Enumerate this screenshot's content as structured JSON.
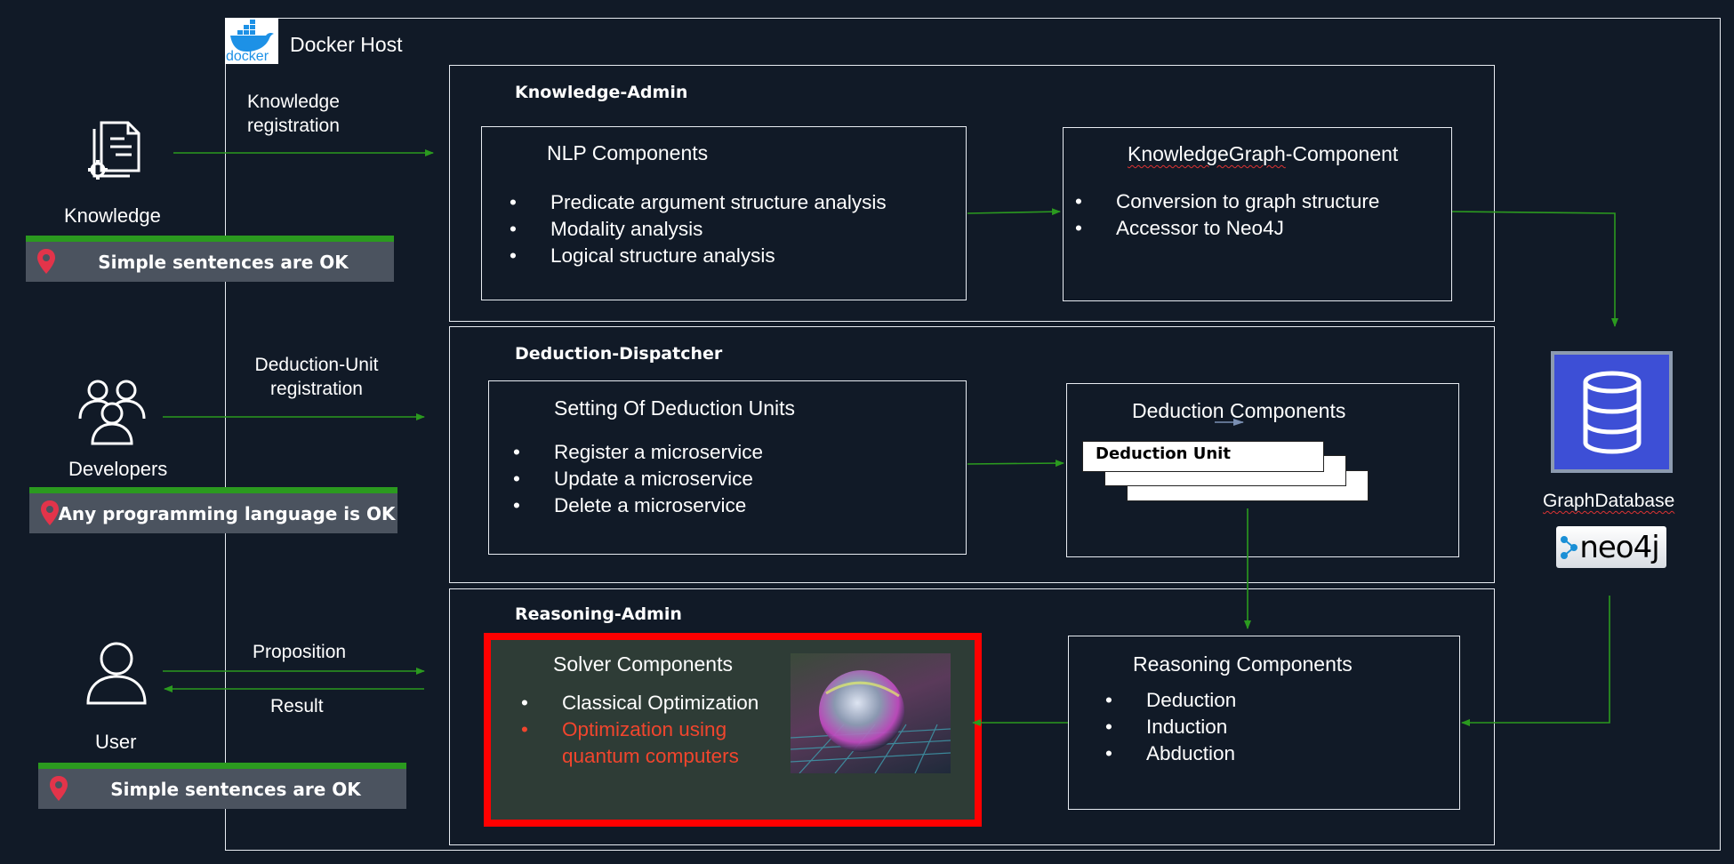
{
  "host": {
    "title": "Docker Host",
    "logo_text": "docker"
  },
  "actors": {
    "knowledge": {
      "label": "Knowledge",
      "note": "Simple sentences are OK",
      "flow": [
        "Knowledge",
        "registration"
      ]
    },
    "developers": {
      "label": "Developers",
      "note": "Any programming language is OK",
      "flow": [
        "Deduction-Unit",
        "registration"
      ]
    },
    "user": {
      "label": "User",
      "note": "Simple sentences are OK",
      "flow_in": "Proposition",
      "flow_out": "Result"
    }
  },
  "sections": {
    "knowledge_admin": {
      "title": "Knowledge-Admin",
      "nlp": {
        "title": "NLP Components",
        "items": [
          "Predicate argument structure analysis",
          "Modality analysis",
          "Logical structure analysis"
        ]
      },
      "kg": {
        "title_a": "KnowledgeGraph",
        "title_b": "-Component",
        "items": [
          "Conversion to graph structure",
          "Accessor to Neo4J"
        ]
      }
    },
    "deduction_dispatcher": {
      "title": "Deduction-Dispatcher",
      "setting": {
        "title": "Setting Of Deduction Units",
        "items": [
          "Register a microservice",
          "Update a microservice",
          "Delete a microservice"
        ]
      },
      "deduction": {
        "title": "Deduction Components",
        "unit_label": "Deduction Unit"
      }
    },
    "reasoning_admin": {
      "title": "Reasoning-Admin",
      "solver": {
        "title": "Solver Components",
        "items": [
          "Classical Optimization"
        ],
        "highlight_items": [
          "Optimization using",
          "quantum computers"
        ]
      },
      "reasoning": {
        "title": "Reasoning Components",
        "items": [
          "Deduction",
          "Induction",
          "Abduction"
        ]
      }
    }
  },
  "database": {
    "label": "GraphDatabase",
    "logo_text": "neo4j"
  },
  "colors": {
    "background": "#111a27",
    "arrow": "#2b9a1f",
    "highlight": "#f1452d",
    "frame": "#e8ecf2",
    "note_bar": "#2b9a1f",
    "db_icon": "#3d4fd6"
  }
}
